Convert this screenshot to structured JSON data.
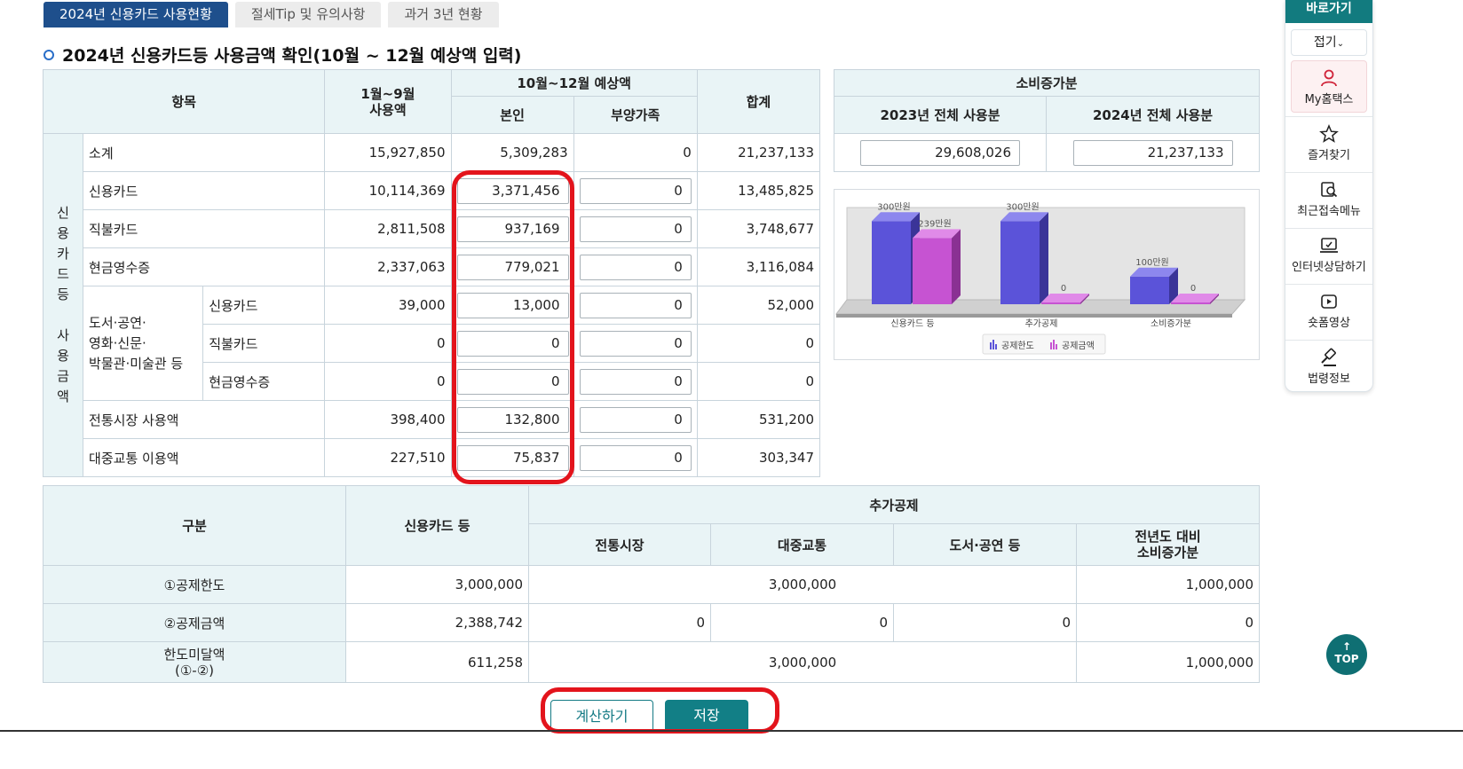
{
  "tabs": [
    {
      "label": "2024년 신용카드 사용현황",
      "active": true
    },
    {
      "label": "절세Tip 및 유의사항",
      "active": false
    },
    {
      "label": "과거 3년 현황",
      "active": false
    }
  ],
  "page_title": "2024년 신용카드등 사용금액 확인(10월 ~ 12월 예상액 입력)",
  "main_table": {
    "headers": {
      "item": "항목",
      "jan_sep": "1월~9월\n사용액",
      "oct_dec": "10월~12월 예상액",
      "self": "본인",
      "dependent": "부양가족",
      "total": "합계"
    },
    "group_label": "신용카드등 사용금액",
    "group_label_chars": [
      "신",
      "용",
      "카",
      "드",
      "등",
      "",
      "사",
      "용",
      "금",
      "액"
    ],
    "rows": {
      "subtotal": {
        "label": "소계",
        "jan_sep": "15,927,850",
        "self": "5,309,283",
        "dependent": "0",
        "total": "21,237,133"
      },
      "credit": {
        "label": "신용카드",
        "jan_sep": "10,114,369",
        "self": "3,371,456",
        "dependent": "0",
        "total": "13,485,825"
      },
      "debit": {
        "label": "직불카드",
        "jan_sep": "2,811,508",
        "self": "937,169",
        "dependent": "0",
        "total": "3,748,677"
      },
      "cash": {
        "label": "현금영수증",
        "jan_sep": "2,337,063",
        "self": "779,021",
        "dependent": "0",
        "total": "3,116,084"
      },
      "culture_label": "도서·공연·\n영화·신문·\n박물관·미술관 등",
      "culture_credit": {
        "label": "신용카드",
        "jan_sep": "39,000",
        "self": "13,000",
        "dependent": "0",
        "total": "52,000"
      },
      "culture_debit": {
        "label": "직불카드",
        "jan_sep": "0",
        "self": "0",
        "dependent": "0",
        "total": "0"
      },
      "culture_cash": {
        "label": "현금영수증",
        "jan_sep": "0",
        "self": "0",
        "dependent": "0",
        "total": "0"
      },
      "market": {
        "label": "전통시장 사용액",
        "jan_sep": "398,400",
        "self": "132,800",
        "dependent": "0",
        "total": "531,200"
      },
      "transit": {
        "label": "대중교통 이용액",
        "jan_sep": "227,510",
        "self": "75,837",
        "dependent": "0",
        "total": "303,347"
      }
    }
  },
  "side_table": {
    "title": "소비증가분",
    "col_2023": "2023년 전체 사용분",
    "col_2024": "2024년 전체 사용분",
    "val_2023": "29,608,026",
    "val_2024": "21,237,133"
  },
  "chart_data": {
    "type": "bar",
    "categories": [
      "신용카드 등",
      "추가공제",
      "소비증가분"
    ],
    "series": [
      {
        "name": "공제한도",
        "values": [
          300,
          300,
          100
        ],
        "labels": [
          "300만원",
          "300만원",
          "100만원"
        ]
      },
      {
        "name": "공제금액",
        "values": [
          239,
          0,
          0
        ],
        "labels": [
          "239만원",
          "0",
          "0"
        ]
      }
    ],
    "ylim": [
      0,
      320
    ],
    "legend": "bottom-center",
    "colors": {
      "limit": "#5a52d6",
      "amount": "#c24ccf"
    }
  },
  "bottom_table": {
    "headers": {
      "category": "구분",
      "card": "신용카드 등",
      "extra": "추가공제",
      "market": "전통시장",
      "transit": "대중교통",
      "culture": "도서·공연 등",
      "increase": "전년도 대비\n소비증가분"
    },
    "rows": {
      "limit": {
        "label": "①공제한도",
        "card": "3,000,000",
        "extra": "3,000,000",
        "increase": "1,000,000"
      },
      "amount": {
        "label": "②공제금액",
        "card": "2,388,742",
        "market": "0",
        "transit": "0",
        "culture": "0",
        "increase": "0"
      },
      "remain": {
        "label": "한도미달액\n(①-②)",
        "card": "611,258",
        "extra": "3,000,000",
        "increase": "1,000,000"
      }
    }
  },
  "buttons": {
    "calculate": "계산하기",
    "save": "저장"
  },
  "quick_menu": {
    "title": "바로가기",
    "fold": "접기",
    "items": [
      {
        "label": "My홈택스",
        "icon": "person-icon"
      },
      {
        "label": "즐겨찾기",
        "icon": "star-icon"
      },
      {
        "label": "최근접속메뉴",
        "icon": "recent-icon"
      },
      {
        "label": "인터넷상담하기",
        "icon": "chat-icon"
      },
      {
        "label": "숏폼영상",
        "icon": "video-icon"
      },
      {
        "label": "법령정보",
        "icon": "gavel-icon"
      }
    ]
  },
  "top_button": {
    "arrow": "↑",
    "label": "TOP"
  }
}
